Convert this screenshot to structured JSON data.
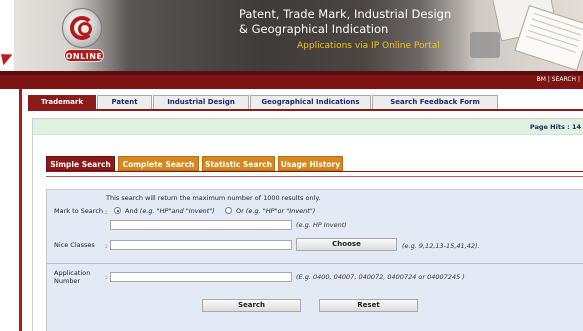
{
  "banner": {
    "logo_text": "ONLINE",
    "title_line1": "Patent, Trade Mark, Industrial Design",
    "title_line2": "& Geographical Indication",
    "subtitle": "Applications  via IP Online Portal"
  },
  "top_links": "BM | SEARCH |",
  "main_tabs": [
    {
      "label": "Trademark",
      "active": true
    },
    {
      "label": "Patent",
      "active": false
    },
    {
      "label": "Industrial Design",
      "active": false
    },
    {
      "label": "Geographical Indications",
      "active": false
    },
    {
      "label": "Search Feedback Form",
      "active": false
    }
  ],
  "page_hits": "Page Hits : 14",
  "sub_tabs": [
    {
      "label": "Simple Search",
      "active": true
    },
    {
      "label": "Complete Search",
      "active": false
    },
    {
      "label": "Statistic Search",
      "active": false
    },
    {
      "label": "Usage History",
      "active": false
    }
  ],
  "form": {
    "info": "This search will return the maximum number of 1000 results only.",
    "mark_label": "Mark to Search",
    "colon": ":",
    "and_label": "And",
    "and_example": "(e.g. \"HP\"and \"Invent\")",
    "or_label": "Or",
    "or_example": "(e.g. \"HP\"or \"Invent\")",
    "mark_value": "",
    "mark_hint": "(e.g. HP Invent)",
    "nice_label": "Nice Classes",
    "nice_value": "",
    "choose_label": "Choose",
    "nice_hint": "(e.g. 9,12,13-15,41,42).",
    "app_label_1": "Application",
    "app_label_2": "Number",
    "app_value": "",
    "app_hint": "(E.g. 0400, 04007, 040072, 0400724 or 04007245 )",
    "search_label": "Search",
    "reset_label": "Reset"
  }
}
